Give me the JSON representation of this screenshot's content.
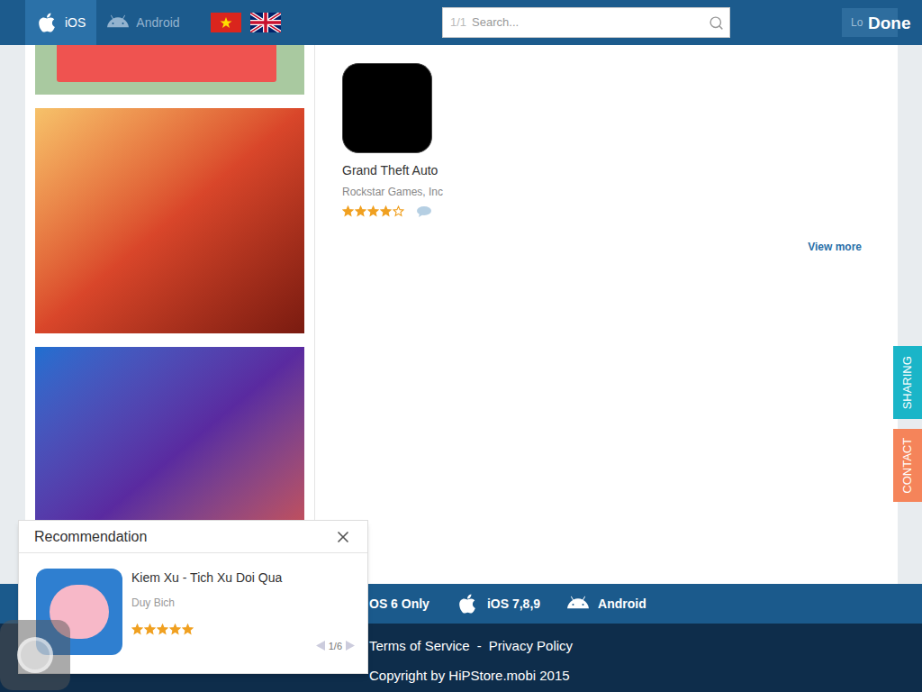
{
  "header": {
    "platform_tabs": [
      {
        "label": "iOS",
        "kind": "apple",
        "selected": true
      },
      {
        "label": "Android",
        "kind": "android",
        "selected": false
      }
    ],
    "search": {
      "counter": "1/1",
      "placeholder": "Search..."
    },
    "login": "Lo",
    "done": "Done"
  },
  "apps": [
    {
      "name": "Grand Theft Auto",
      "developer": "Rockstar Games, Inc",
      "stars": 4
    }
  ],
  "view_more": "View more",
  "side_tabs": [
    {
      "label": "SHARING",
      "color": "#1ab5c8"
    },
    {
      "label": "CONTACT",
      "color": "#f5845a"
    }
  ],
  "footer": {
    "platforms": [
      {
        "label": "OS 6 Only",
        "kind": "plain"
      },
      {
        "label": "iOS 7,8,9",
        "kind": "apple"
      },
      {
        "label": "Android",
        "kind": "android"
      }
    ],
    "links": [
      "Terms of Service",
      "Privacy Policy"
    ],
    "separator": "-",
    "copyright": "Copyright by HiPStore.mobi 2015"
  },
  "recommendation": {
    "title": "Recommendation",
    "item": {
      "name": "Kiem Xu - Tich Xu Doi Qua",
      "developer": "Duy Bich",
      "stars": 5
    },
    "pager": "1/6"
  }
}
